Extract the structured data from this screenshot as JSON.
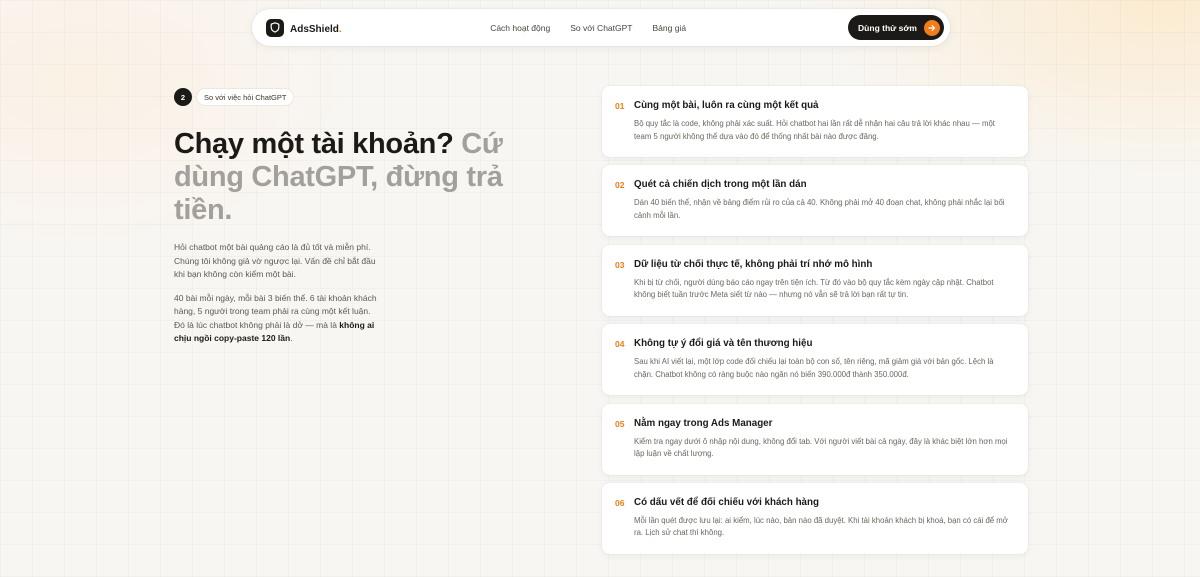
{
  "nav": {
    "brand": "AdsShield",
    "brand_dot": ".",
    "links": [
      "Cách hoạt động",
      "So với ChatGPT",
      "Bảng giá"
    ],
    "cta": "Dùng thử sớm"
  },
  "section": {
    "step": "2",
    "eyebrow": "So với việc hỏi ChatGPT",
    "headline_dark": "Chạy một tài khoản?",
    "headline_muted": "Cứ dùng ChatGPT, đừng trả tiền.",
    "para1": "Hỏi chatbot một bài quảng cáo là đủ tốt và miễn phí. Chúng tôi không giả vờ ngược lại. Vấn đề chỉ bắt đầu khi bạn không còn kiểm một bài.",
    "para2_text": "40 bài mỗi ngày, mỗi bài 3 biến thể. 6 tài khoản khách hàng, 5 người trong team phải ra cùng một kết luận. Đó là lúc chatbot không phải là dở — mà là ",
    "para2_bold": "không ai chịu ngồi copy-paste 120 lần",
    "para2_end": "."
  },
  "cards": [
    {
      "num": "01",
      "title": "Cùng một bài, luôn ra cùng một kết quả",
      "desc": "Bộ quy tắc là code, không phải xác suất. Hỏi chatbot hai lần rất dễ nhận hai câu trả lời khác nhau — một team 5 người không thể dựa vào đó để thống nhất bài nào được đăng."
    },
    {
      "num": "02",
      "title": "Quét cả chiến dịch trong một lần dán",
      "desc": "Dán 40 biến thể, nhận về bảng điểm rủi ro của cả 40. Không phải mở 40 đoạn chat, không phải nhắc lại bối cảnh mỗi lần."
    },
    {
      "num": "03",
      "title": "Dữ liệu từ chối thực tế, không phải trí nhớ mô hình",
      "desc": "Khi bị từ chối, người dùng báo cáo ngay trên tiện ích. Từ đó vào bộ quy tắc kèm ngày cập nhật. Chatbot không biết tuần trước Meta siết từ nào — nhưng nó vẫn sẽ trả lời bạn rất tự tin."
    },
    {
      "num": "04",
      "title": "Không tự ý đổi giá và tên thương hiệu",
      "desc": "Sau khi AI viết lại, một lớp code đối chiếu lại toàn bộ con số, tên riêng, mã giảm giá với bản gốc. Lệch là chặn. Chatbot không có ràng buộc nào ngăn nó biến 390.000đ thành 350.000đ."
    },
    {
      "num": "05",
      "title": "Nằm ngay trong Ads Manager",
      "desc": "Kiểm tra ngay dưới ô nhập nội dung, không đổi tab. Với người viết bài cả ngày, đây là khác biệt lớn hơn mọi lập luận về chất lượng."
    },
    {
      "num": "06",
      "title": "Có dấu vết để đối chiếu với khách hàng",
      "desc": "Mỗi lần quét được lưu lại: ai kiểm, lúc nào, bản nào đã duyệt. Khi tài khoản khách bị khoá, bạn có cái để mở ra. Lịch sử chat thì không."
    }
  ],
  "colors": {
    "accent": "#f07d1a",
    "ink": "#1c1a17",
    "muted": "#a3a09b"
  }
}
